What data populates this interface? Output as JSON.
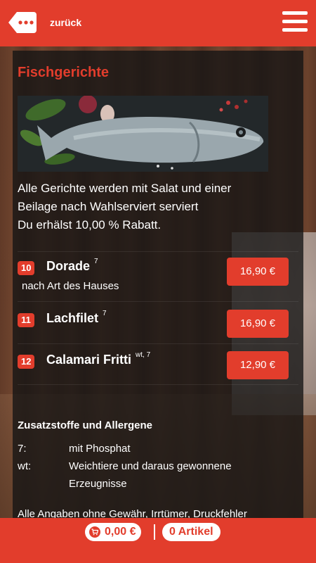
{
  "header": {
    "back_label": "zurück"
  },
  "section": {
    "title": "Fischgerichte",
    "intro_lines": [
      "Alle Gerichte werden mit Salat und einer",
      "Beilage nach Wahlserviert serviert",
      "Du erhälst 10,00 % Rabatt."
    ]
  },
  "items": [
    {
      "number": "10",
      "name": "Dorade",
      "sup": "7",
      "description": "nach Art des Hauses",
      "price": "16,90 €"
    },
    {
      "number": "11",
      "name": "Lachfilet",
      "sup": "7",
      "description": "",
      "price": "16,90 €"
    },
    {
      "number": "12",
      "name": "Calamari Fritti",
      "sup": "wt, 7",
      "description": "",
      "price": "12,90 €"
    }
  ],
  "allergens": {
    "title": "Zusatzstoffe und Allergene",
    "entries": [
      {
        "code": "7:",
        "text": "mit Phosphat"
      },
      {
        "code": "wt:",
        "text": "Weichtiere und daraus gewonnene Erzeugnisse"
      }
    ]
  },
  "disclaimer": "Alle Angaben ohne Gewähr, Irrtümer, Druckfehler",
  "footer": {
    "cart_total": "0,00 €",
    "separator": "|",
    "article_count": "0 Artikel"
  },
  "colors": {
    "accent": "#e23d2c"
  }
}
